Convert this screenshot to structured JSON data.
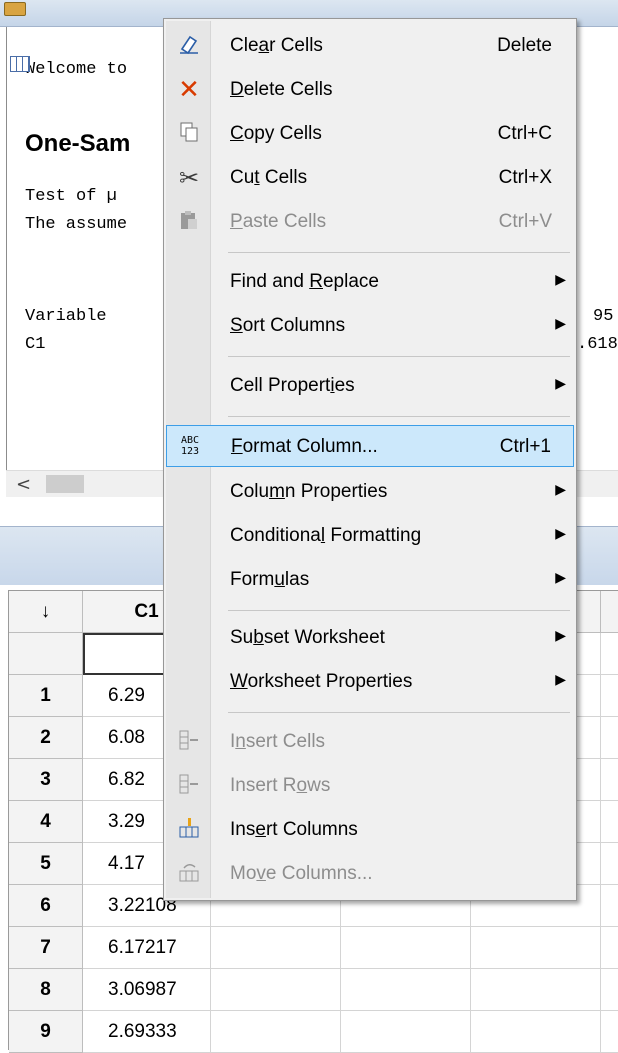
{
  "session": {
    "line_welcome": "Welcome to",
    "heading": "One-Sam",
    "line_test": "Test of µ",
    "line_assume": "The assume",
    "col_variable": "Variable",
    "row_c1": "C1",
    "right_top": "95",
    "right_bottom": ".618"
  },
  "scroll": {
    "left_arrow": "<"
  },
  "worksheet": {
    "sort_arrow": "↓",
    "column_header": "C1",
    "rows": [
      {
        "n": "1",
        "v": "6.29"
      },
      {
        "n": "2",
        "v": "6.08"
      },
      {
        "n": "3",
        "v": "6.82"
      },
      {
        "n": "4",
        "v": "3.29"
      },
      {
        "n": "5",
        "v": "4.17"
      },
      {
        "n": "6",
        "v": "3.22108"
      },
      {
        "n": "7",
        "v": "6.17217"
      },
      {
        "n": "8",
        "v": "3.06987"
      },
      {
        "n": "9",
        "v": "2.69333"
      }
    ]
  },
  "menu": {
    "clear": {
      "pre": "Cle",
      "u": "a",
      "post": "r Cells",
      "shortcut": "Delete"
    },
    "delete": {
      "pre": "",
      "u": "D",
      "post": "elete Cells"
    },
    "copy": {
      "pre": "",
      "u": "C",
      "post": "opy Cells",
      "shortcut": "Ctrl+C"
    },
    "cut": {
      "pre": "Cu",
      "u": "t",
      "post": " Cells",
      "shortcut": "Ctrl+X"
    },
    "paste": {
      "pre": "",
      "u": "P",
      "post": "aste Cells",
      "shortcut": "Ctrl+V"
    },
    "find": {
      "pre": "Find and ",
      "u": "R",
      "post": "eplace"
    },
    "sort": {
      "pre": "",
      "u": "S",
      "post": "ort Columns"
    },
    "cellprops": {
      "pre": "Cell Propert",
      "u": "i",
      "post": "es"
    },
    "format": {
      "pre": "",
      "u": "F",
      "post": "ormat Column...",
      "shortcut": "Ctrl+1",
      "icon_text": "ABC\n123"
    },
    "colprops": {
      "pre": "Colu",
      "u": "m",
      "post": "n Properties"
    },
    "condfmt": {
      "pre": "Conditiona",
      "u": "l",
      "post": " Formatting"
    },
    "formulas": {
      "pre": "Form",
      "u": "u",
      "post": "las"
    },
    "subset": {
      "pre": "Su",
      "u": "b",
      "post": "set Worksheet"
    },
    "wsprops": {
      "pre": "",
      "u": "W",
      "post": "orksheet Properties"
    },
    "inscells": {
      "pre": "I",
      "u": "n",
      "post": "sert Cells"
    },
    "insrows": {
      "pre": "Insert R",
      "u": "o",
      "post": "ws"
    },
    "inscols": {
      "pre": "Ins",
      "u": "e",
      "post": "rt Columns"
    },
    "movecols": {
      "pre": "Mo",
      "u": "v",
      "post": "e Columns..."
    },
    "submenu_arrow": "▶"
  },
  "colors": {
    "highlight": "#cce8fb",
    "highlight_border": "#3d9ee7",
    "delete_red": "#d83b01"
  }
}
